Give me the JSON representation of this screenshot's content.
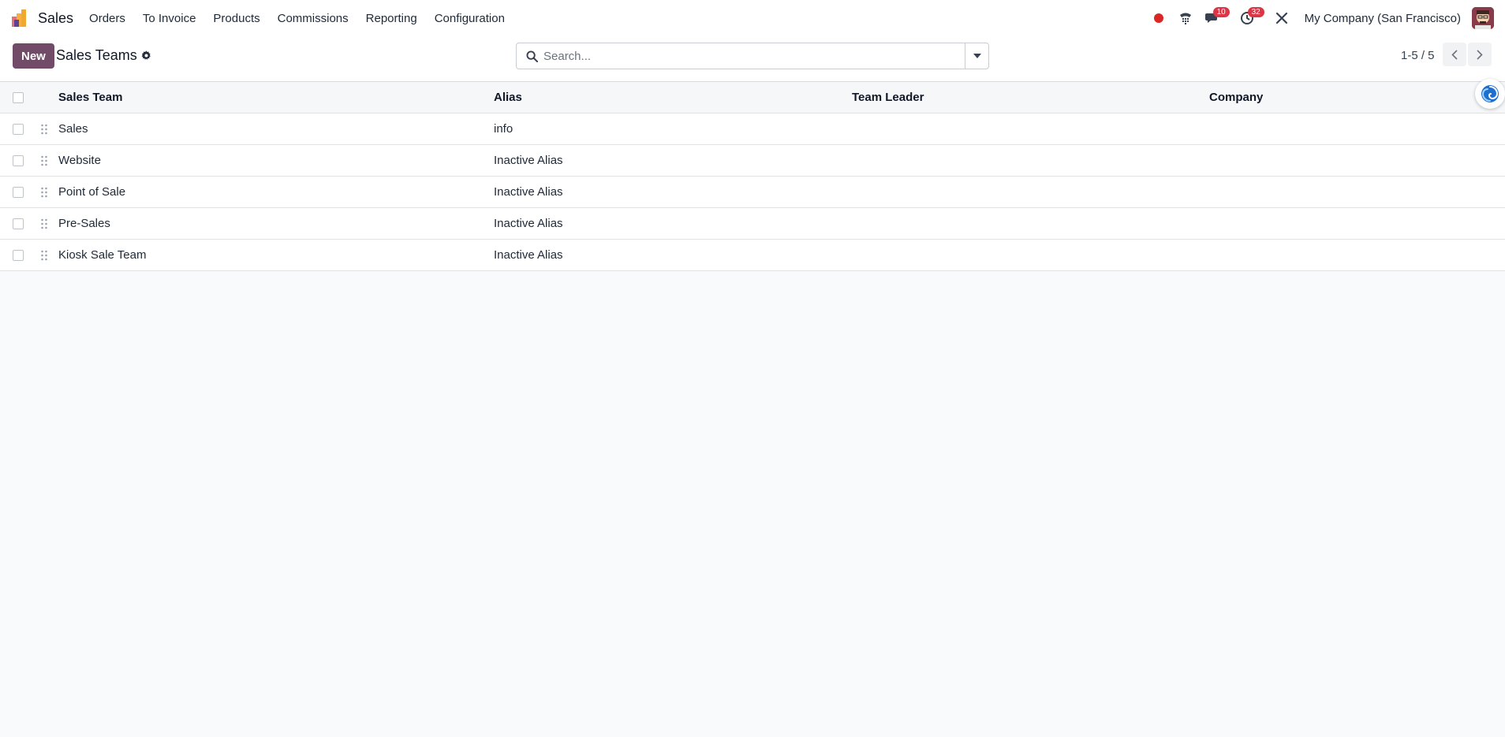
{
  "navbar": {
    "app_name": "Sales",
    "menu": [
      {
        "label": "Orders"
      },
      {
        "label": "To Invoice"
      },
      {
        "label": "Products"
      },
      {
        "label": "Commissions"
      },
      {
        "label": "Reporting"
      },
      {
        "label": "Configuration"
      }
    ],
    "messages_count": "10",
    "activities_count": "32",
    "company": "My Company (San Francisco)",
    "icons": [
      "app-logo-icon",
      "record-dot-icon",
      "phone-icon",
      "chat-icon",
      "clock-icon",
      "debug-tools-icon",
      "avatar"
    ]
  },
  "control_panel": {
    "new_label": "New",
    "title": "Sales Teams",
    "search_placeholder": "Search...",
    "pager_text": "1-5 / 5"
  },
  "list": {
    "columns": [
      "Sales Team",
      "Alias",
      "Team Leader",
      "Company"
    ],
    "rows": [
      {
        "team": "Sales",
        "alias": "info",
        "leader": "",
        "company": ""
      },
      {
        "team": "Website",
        "alias": "Inactive Alias",
        "leader": "",
        "company": ""
      },
      {
        "team": "Point of Sale",
        "alias": "Inactive Alias",
        "leader": "",
        "company": ""
      },
      {
        "team": "Pre-Sales",
        "alias": "Inactive Alias",
        "leader": "",
        "company": ""
      },
      {
        "team": "Kiosk Sale Team",
        "alias": "Inactive Alias",
        "leader": "",
        "company": ""
      }
    ]
  },
  "colors": {
    "primary": "#714b67",
    "badge": "#dc3545",
    "record": "#dc2626"
  }
}
